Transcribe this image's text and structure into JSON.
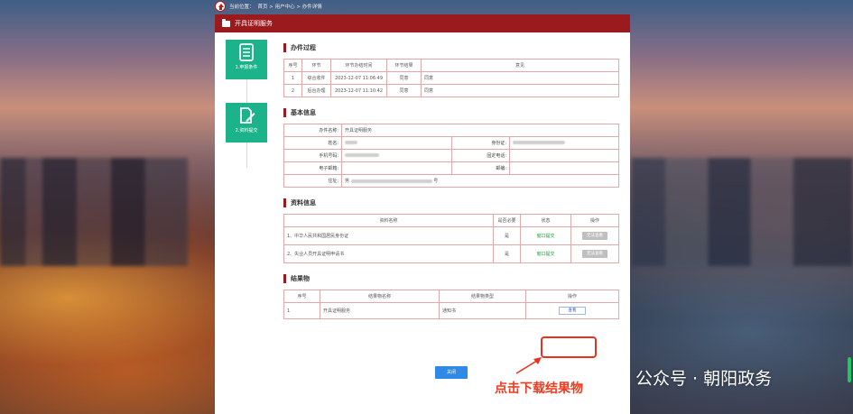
{
  "breadcrumb": {
    "prefix": "当前位置：",
    "path": "首页 > 用户中心 > 办件详情"
  },
  "header": {
    "title": "开具证明服务"
  },
  "steps": [
    {
      "label": "1.申报条件"
    },
    {
      "label": "2.资料提交"
    }
  ],
  "process": {
    "title": "办件过程",
    "headers": [
      "序号",
      "环节",
      "环节办结时间",
      "环节结果",
      "意见"
    ],
    "rows": [
      [
        "1",
        "综合收件",
        "2023-12-07 11:06:49",
        "同意",
        "同意"
      ],
      [
        "2",
        "后台办理",
        "2023-12-07 11:10:42",
        "同意",
        "同意"
      ]
    ]
  },
  "basic": {
    "title": "基本信息",
    "case_name_label": "办件名称:",
    "case_name": "开具证明服务",
    "name_label": "姓名:",
    "id_label": "身份证:",
    "mobile_label": "手机号码:",
    "phone_label": "固定电话:",
    "email_label": "电子邮箱:",
    "postcode_label": "邮编:",
    "address_label": "住址:",
    "address_prefix": "男",
    "address_suffix": "号"
  },
  "materials": {
    "title": "资料信息",
    "headers": [
      "资料名称",
      "是否必要",
      "状态",
      "操作"
    ],
    "rows": [
      {
        "name": "1、中华人民共和国居民身份证",
        "required": "是",
        "status": "窗口提交",
        "action": "无法查看"
      },
      {
        "name": "2、失业人员开具证明申请书",
        "required": "是",
        "status": "窗口提交",
        "action": "无法查看"
      }
    ]
  },
  "results": {
    "title": "结果物",
    "headers": [
      "序号",
      "结果物名称",
      "结果物类型",
      "操作"
    ],
    "rows": [
      {
        "no": "1",
        "name": "开具证明服务",
        "type": "通知书",
        "action": "查看"
      }
    ]
  },
  "return_button": "关闭",
  "annotation": "点击下载结果物",
  "watermark": "公众号 · 朝阳政务",
  "colors": {
    "brand": "#9a1a1d",
    "step": "#1db38a",
    "annotation": "#f03a1e",
    "button": "#2e8ae6"
  }
}
